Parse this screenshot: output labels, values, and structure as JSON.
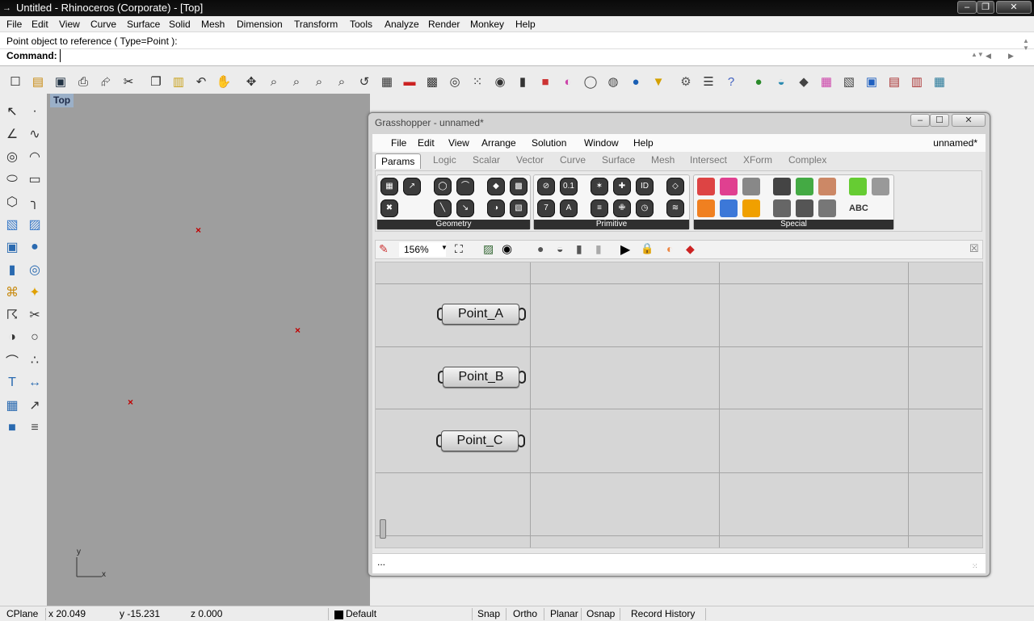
{
  "window": {
    "title": "Untitled - Rhinoceros (Corporate) - [Top]",
    "minimize": "–",
    "restore": "❐",
    "close": "✕"
  },
  "menu": [
    "File",
    "Edit",
    "View",
    "Curve",
    "Surface",
    "Solid",
    "Mesh",
    "Dimension",
    "Transform",
    "Tools",
    "Analyze",
    "Render",
    "Monkey",
    "Help"
  ],
  "command": {
    "history": "Point object to reference ( Type=Point ):",
    "label": "Command:",
    "value": ""
  },
  "toolbar_icons": [
    "new-file-icon",
    "open-file-icon",
    "save-icon",
    "print-icon",
    "import-icon",
    "cut-icon",
    "copy-icon",
    "paste-icon",
    "undo-icon",
    "pan-hand-icon",
    "rotate-view-icon",
    "zoom-icon",
    "zoom-window-icon",
    "zoom-extents-icon",
    "zoom-selected-icon",
    "undo-view-icon",
    "four-viewports-icon",
    "car-icon",
    "grid-icon",
    "snap-target-icon",
    "point-cloud-icon",
    "light-bulb-icon",
    "lock-icon",
    "layer-icon",
    "color-wheel-icon",
    "sphere-wire-icon",
    "sphere-mesh-icon",
    "blue-sphere-icon",
    "filter-icon",
    "gear-settings-icon",
    "hierarchy-icon",
    "help-icon",
    "render-sphere-icon",
    "environment-icon",
    "material-icon",
    "palette-icon",
    "texture-icon",
    "camera-icon",
    "frame-icon",
    "frame2-icon",
    "mesh-grid-icon"
  ],
  "viewport": {
    "name": "Top",
    "axis_y": "y",
    "axis_x": "x"
  },
  "status": {
    "cplane": "CPlane",
    "x": "x 20.049",
    "y": "y -15.231",
    "z": "z 0.000",
    "layer": "Default",
    "layer_color": "#000000",
    "toggles": [
      "Snap",
      "Ortho",
      "Planar",
      "Osnap",
      "Record History"
    ]
  },
  "grasshopper": {
    "title": "Grasshopper - unnamed*",
    "menu": [
      "File",
      "Edit",
      "View",
      "Arrange",
      "Solution",
      "Window",
      "Help"
    ],
    "document": "unnamed*",
    "tabs": [
      "Params",
      "Logic",
      "Scalar",
      "Vector",
      "Curve",
      "Surface",
      "Mesh",
      "Intersect",
      "XForm",
      "Complex"
    ],
    "active_tab": "Params",
    "groups": [
      {
        "label": "Geometry"
      },
      {
        "label": "Primitive"
      },
      {
        "label": "Special"
      }
    ],
    "zoom": "156%",
    "nodes": [
      {
        "label": "Point_A"
      },
      {
        "label": "Point_B"
      },
      {
        "label": "Point_C"
      }
    ],
    "status": "..."
  }
}
